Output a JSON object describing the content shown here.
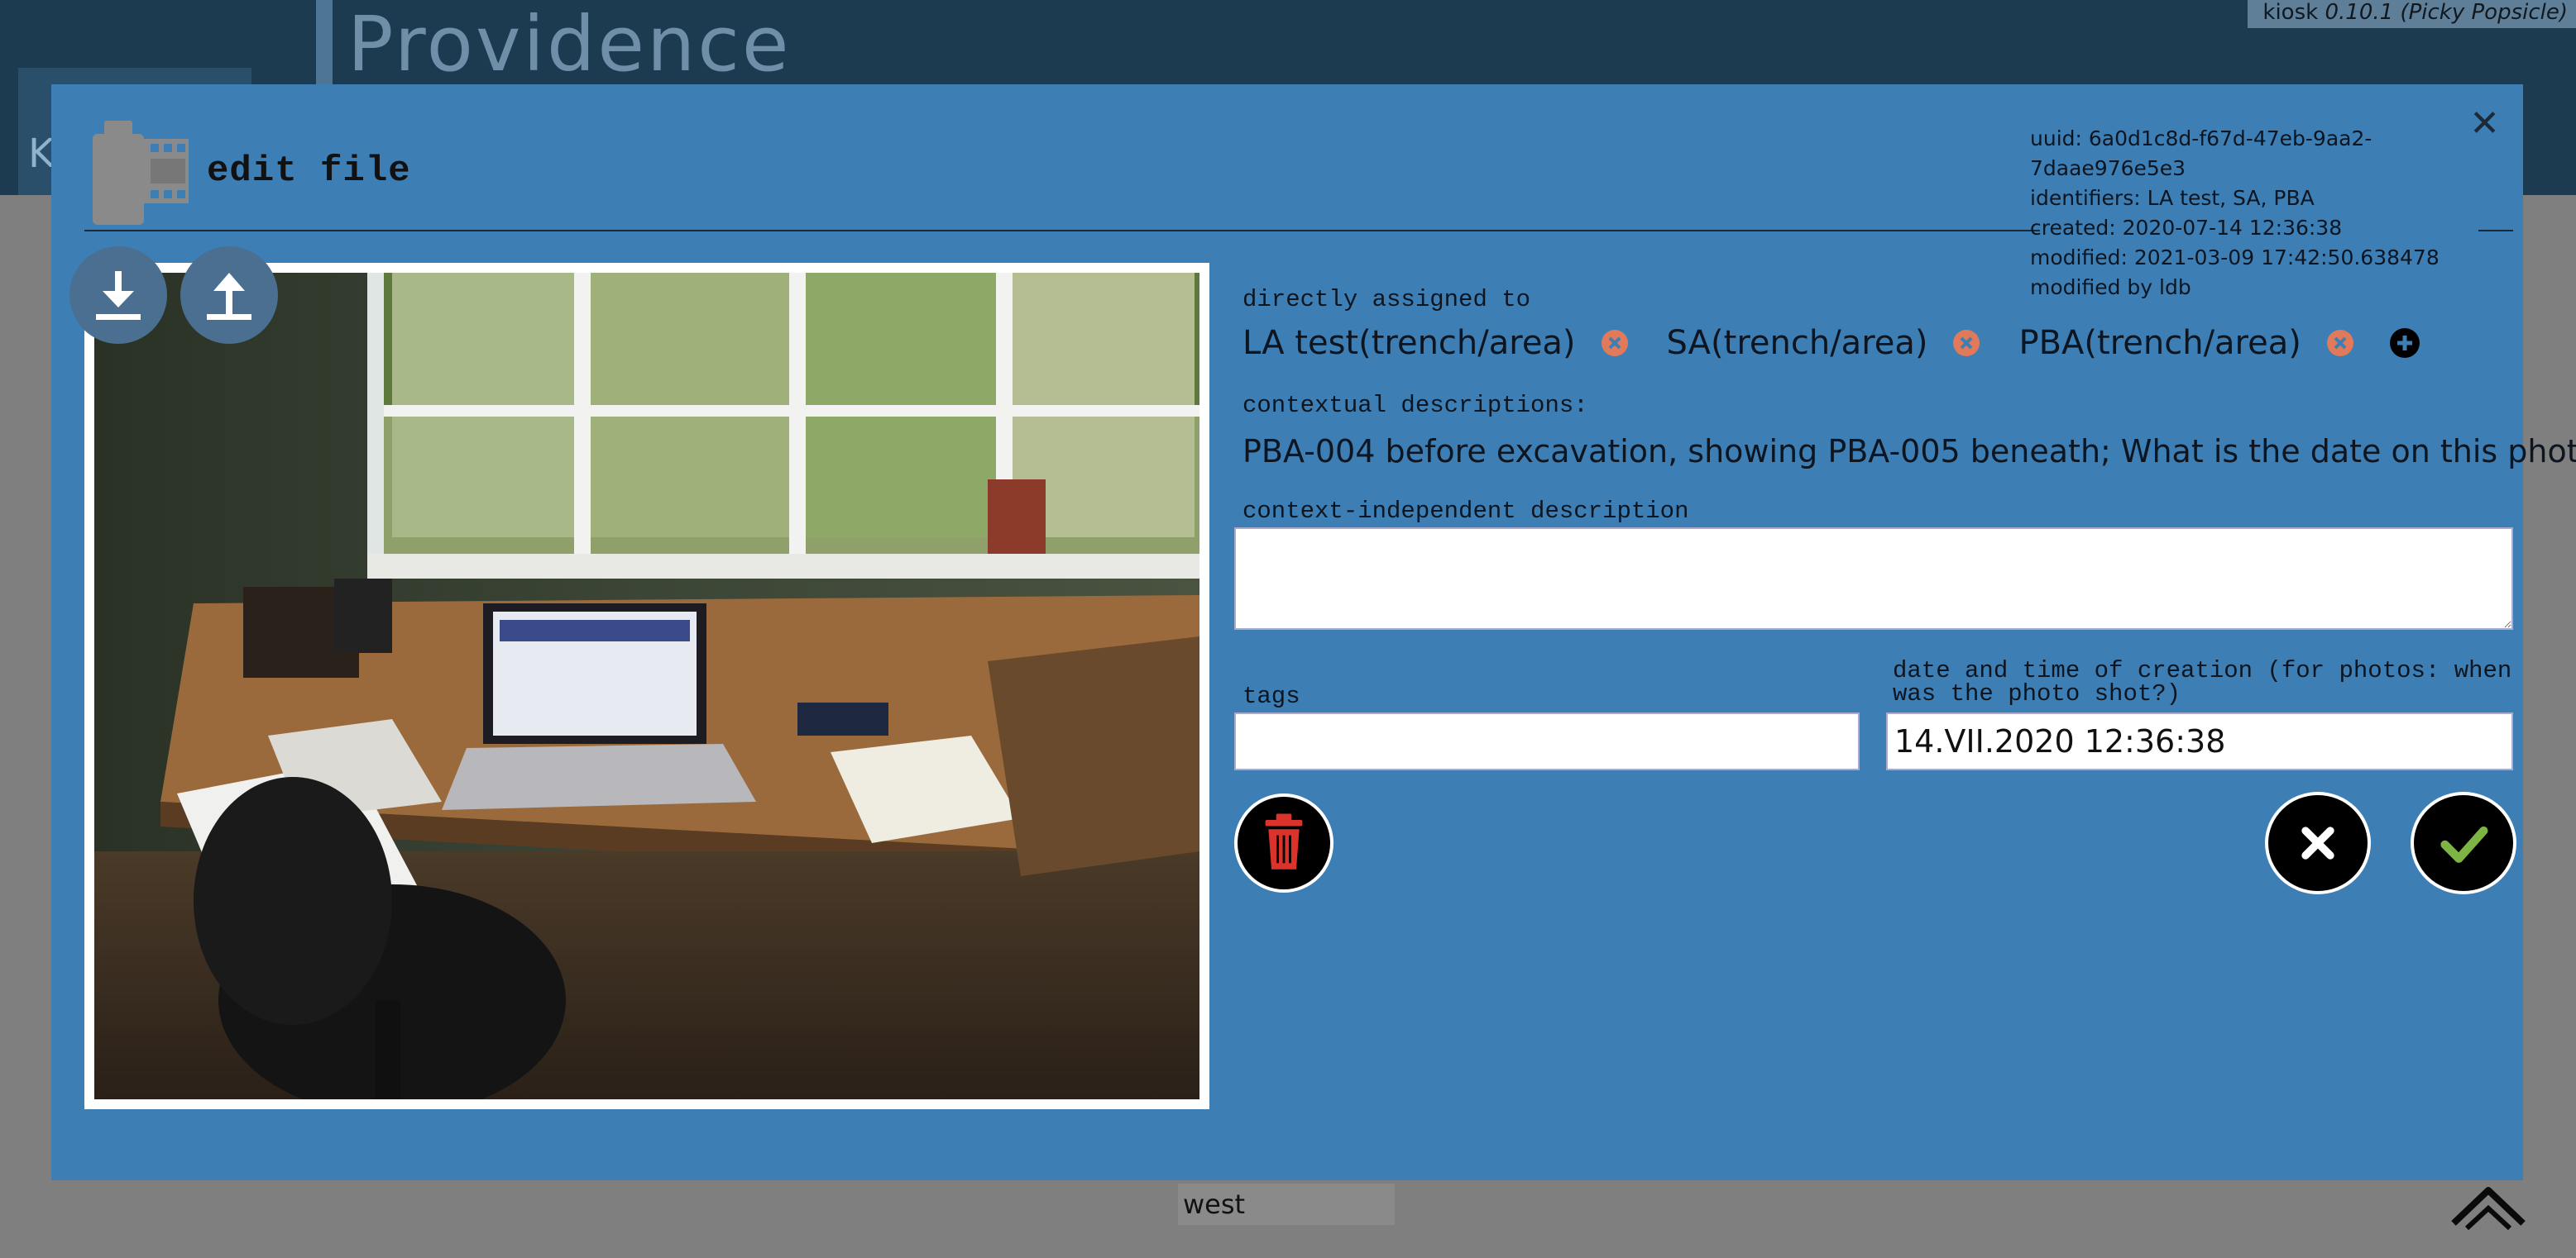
{
  "background": {
    "app_title": "Providence",
    "left_letter": "K",
    "version_prefix": "kiosk",
    "version_number": "0.10.1 (Picky Popsicle)",
    "list_item": "west"
  },
  "modal": {
    "title": "edit file",
    "close_icon": "close-icon",
    "meta": {
      "uuid": "uuid: 6a0d1c8d-f67d-47eb-9aa2-7daae976e5e3",
      "identifiers": "identifiers: LA test, SA, PBA",
      "created": "created: 2020-07-14 12:36:38",
      "modified": "modified: 2021-03-09 17:42:50.638478",
      "modified_by": "modified by ldb"
    },
    "photo_buttons": [
      "download-icon",
      "upload-icon"
    ],
    "assigned": {
      "label": "directly assigned to",
      "items": [
        "LA test(trench/area)",
        "SA(trench/area)",
        "PBA(trench/area)"
      ]
    },
    "contextual": {
      "label": "contextual descriptions:",
      "text": "PBA-004 before excavation, showing PBA-005 beneath; What is the date on this photo?"
    },
    "independent": {
      "label": "context-independent description",
      "value": ""
    },
    "tags": {
      "label": "tags",
      "value": ""
    },
    "creation": {
      "label_line1": "date and time of creation (for photos: when",
      "label_line2": "was the photo shot?)",
      "value": "14.VII.2020 12:36:38"
    },
    "colors": {
      "modal_bg": "#3d7fb4",
      "remove": "#e07a5a",
      "trash": "#d9332b",
      "ok": "#7db443"
    }
  }
}
